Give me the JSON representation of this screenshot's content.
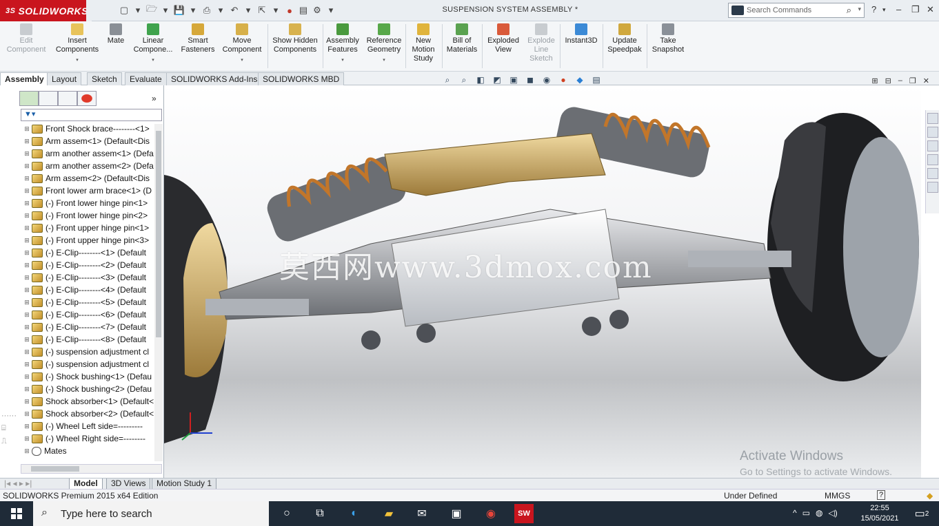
{
  "app": {
    "brand": "SOLIDWORKS",
    "document_title": "SUSPENSION SYSTEM ASSEMBLY *",
    "search_placeholder": "Search Commands"
  },
  "ribbon": [
    {
      "label": "Edit Component",
      "icon": "edit-component-icon",
      "disabled": true
    },
    {
      "label": "Insert Components",
      "icon": "insert-components-icon"
    },
    {
      "label": "Mate",
      "icon": "mate-icon"
    },
    {
      "label": "Linear Compone...",
      "icon": "linear-pattern-icon"
    },
    {
      "label": "Smart Fasteners",
      "icon": "smart-fasteners-icon"
    },
    {
      "label": "Move Component",
      "icon": "move-component-icon"
    },
    {
      "label": "Show Hidden Components",
      "icon": "show-hidden-icon"
    },
    {
      "label": "Assembly Features",
      "icon": "assembly-features-icon"
    },
    {
      "label": "Reference Geometry",
      "icon": "reference-geometry-icon"
    },
    {
      "label": "New Motion Study",
      "icon": "motion-study-icon"
    },
    {
      "label": "Bill of Materials",
      "icon": "bom-icon"
    },
    {
      "label": "Exploded View",
      "icon": "exploded-view-icon"
    },
    {
      "label": "Explode Line Sketch",
      "icon": "explode-line-icon",
      "disabled": true
    },
    {
      "label": "Instant3D",
      "icon": "instant3d-icon"
    },
    {
      "label": "Update Speedpak",
      "icon": "speedpak-icon"
    },
    {
      "label": "Take Snapshot",
      "icon": "snapshot-icon"
    }
  ],
  "tabs": [
    "Assembly",
    "Layout",
    "Sketch",
    "Evaluate",
    "SOLIDWORKS Add-Ins",
    "SOLIDWORKS MBD"
  ],
  "tree": [
    "Front Shock brace--------<1>",
    "Arm assem<1> (Default<Dis",
    "arm another assem<1> (Defa",
    "arm another assem<2> (Defa",
    "Arm assem<2> (Default<Dis",
    "Front lower arm brace<1> (D",
    "(-) Front lower hinge pin<1>",
    "(-) Front lower hinge pin<2>",
    "(-) Front upper hinge pin<1>",
    "(-) Front upper hinge pin<3>",
    "(-) E-Clip--------<1> (Default",
    "(-) E-Clip--------<2> (Default",
    "(-) E-Clip--------<3> (Default",
    "(-) E-Clip--------<4> (Default",
    "(-) E-Clip--------<5> (Default",
    "(-) E-Clip--------<6> (Default",
    "(-) E-Clip--------<7> (Default",
    "(-) E-Clip--------<8> (Default",
    "(-) suspension adjustment cl",
    "(-) suspension adjustment cl",
    "(-) Shock bushing<1> (Defau",
    "(-) Shock bushing<2> (Defau",
    "Shock absorber<1> (Default<",
    "Shock absorber<2> (Default<",
    "(-) Wheel Left side=---------",
    "(-) Wheel Right side=--------",
    "Mates"
  ],
  "bottom_tabs": [
    "Model",
    "3D Views",
    "Motion Study 1"
  ],
  "status": {
    "edition": "SOLIDWORKS Premium 2015 x64 Edition",
    "state": "Under Defined",
    "units": "MMGS"
  },
  "viewport": {
    "watermark": "莫西网www.3dmox.com",
    "activate_title": "Activate Windows",
    "activate_sub": "Go to Settings to activate Windows."
  },
  "taskbar": {
    "search_placeholder": "Type here to search",
    "time": "22:55",
    "date": "15/05/2021",
    "notifications": "2"
  }
}
